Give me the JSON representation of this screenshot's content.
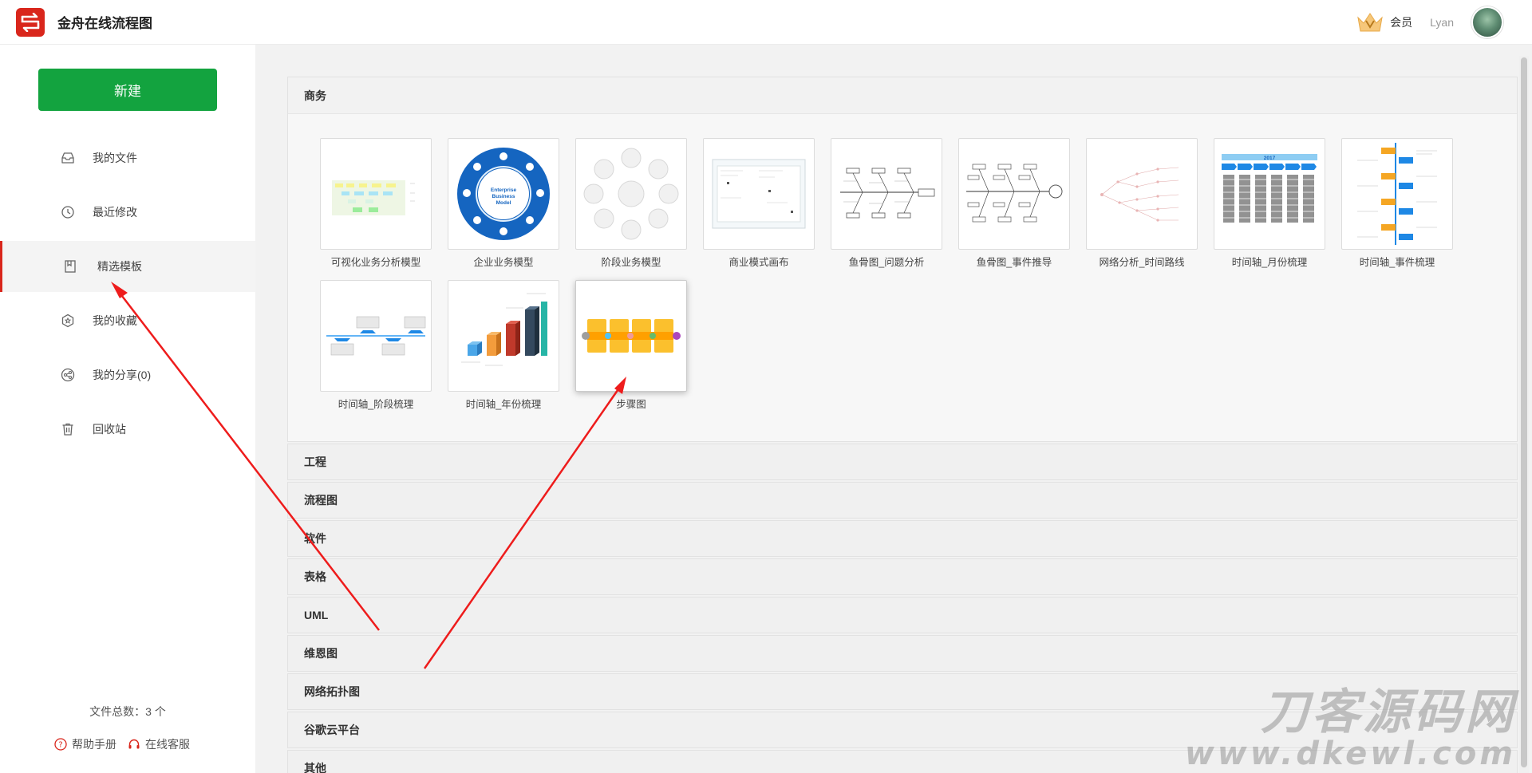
{
  "header": {
    "app_title": "金舟在线流程图",
    "vip_label": "会员",
    "username": "Lyan"
  },
  "sidebar": {
    "new_button": "新建",
    "items": [
      {
        "label": "我的文件",
        "icon": "inbox-icon"
      },
      {
        "label": "最近修改",
        "icon": "clock-icon"
      },
      {
        "label": "精选模板",
        "icon": "bookmark-icon",
        "active": true
      },
      {
        "label": "我的收藏",
        "icon": "star-hexagon-icon"
      },
      {
        "label": "我的分享(0)",
        "icon": "share-icon"
      },
      {
        "label": "回收站",
        "icon": "trash-icon"
      }
    ],
    "file_count": "文件总数：3 个",
    "help_label": "帮助手册",
    "service_label": "在线客服"
  },
  "main": {
    "sections": [
      {
        "title": "商务",
        "open": true
      },
      {
        "title": "工程"
      },
      {
        "title": "流程图"
      },
      {
        "title": "软件"
      },
      {
        "title": "表格"
      },
      {
        "title": "UML"
      },
      {
        "title": "维恩图"
      },
      {
        "title": "网络拓扑图"
      },
      {
        "title": "谷歌云平台"
      },
      {
        "title": "其他"
      }
    ],
    "templates": [
      {
        "name": "可视化业务分析模型",
        "thumb": "analysis"
      },
      {
        "name": "企业业务模型",
        "thumb": "circle-model"
      },
      {
        "name": "阶段业务模型",
        "thumb": "stages"
      },
      {
        "name": "商业模式画布",
        "thumb": "canvas"
      },
      {
        "name": "鱼骨图_问题分析",
        "thumb": "fishbone"
      },
      {
        "name": "鱼骨图_事件推导",
        "thumb": "fishbone2"
      },
      {
        "name": "网络分析_时间路线",
        "thumb": "network"
      },
      {
        "name": "时间轴_月份梳理",
        "thumb": "timeline-month"
      },
      {
        "name": "时间轴_事件梳理",
        "thumb": "timeline-event"
      },
      {
        "name": "时间轴_阶段梳理",
        "thumb": "timeline-stage"
      },
      {
        "name": "时间轴_年份梳理",
        "thumb": "bars-3d"
      },
      {
        "name": "步骤图",
        "thumb": "steps",
        "hover": true
      }
    ],
    "circle_model_text": "Enterprise Business Model",
    "timeline_year": "2017"
  },
  "watermark": {
    "line1": "刀客源码网",
    "line2": "www.dkewl.com"
  }
}
